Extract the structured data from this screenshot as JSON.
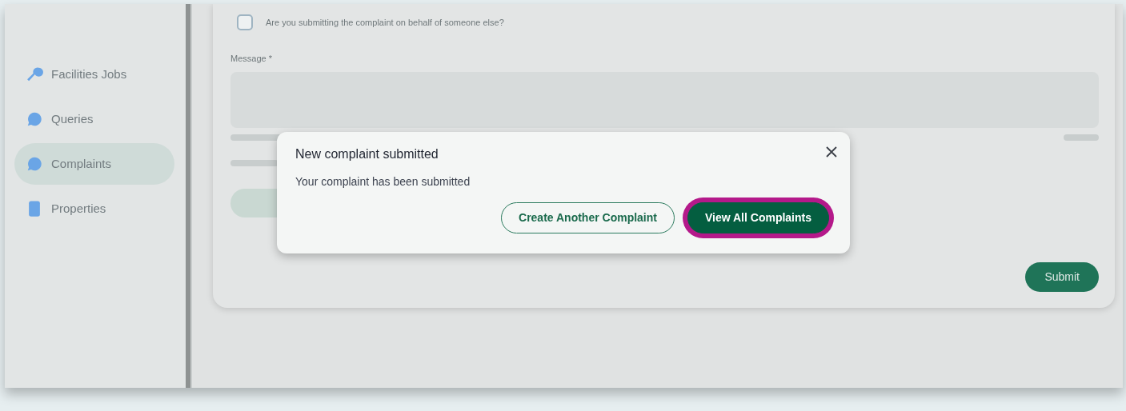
{
  "sidebar": {
    "items": [
      {
        "label": "Facilities Jobs",
        "selected": false
      },
      {
        "label": "Queries",
        "selected": false
      },
      {
        "label": "Complaints",
        "selected": true
      },
      {
        "label": "Properties",
        "selected": false
      }
    ]
  },
  "form": {
    "checkbox": {
      "label": "Are you submitting the complaint on behalf of someone else?",
      "checked": false
    },
    "message": {
      "label": "Message *"
    },
    "submit": "Submit"
  },
  "modal": {
    "title": "New complaint submitted",
    "message": "Your complaint has been submitted",
    "buttons": [
      {
        "label": "Create Another Complaint",
        "kind": "outline",
        "focused": false
      },
      {
        "label": "View All Complaints",
        "kind": "primary",
        "focused": true
      }
    ]
  }
}
